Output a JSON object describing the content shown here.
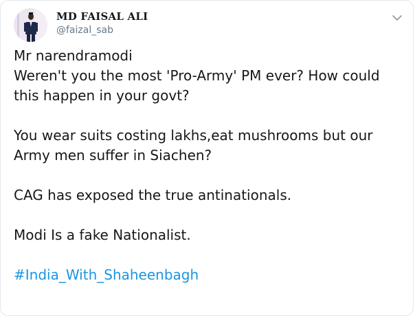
{
  "author": {
    "display_name": "MD FAISAL ALI",
    "handle": "@faizal_sab",
    "avatar_icon": "profile-photo"
  },
  "menu": {
    "icon": "chevron-down-icon"
  },
  "tweet": {
    "paragraph1_line1": "Mr narendramodi",
    "paragraph1_line2": "Weren't you the most 'Pro-Army' PM ever? How could",
    "paragraph1_line3": "this happen in your govt?",
    "paragraph2_line1": "You wear suits costing lakhs,eat mushrooms but our",
    "paragraph2_line2": "Army men suffer in Siachen?",
    "paragraph3": "CAG has exposed the true antinationals.",
    "paragraph4": "Modi Is a fake Nationalist.",
    "hashtag": "#India_With_Shaheenbagh"
  },
  "colors": {
    "link": "#1b95e0",
    "text": "#14171a",
    "secondary": "#657786",
    "border": "#e1e8ed"
  }
}
